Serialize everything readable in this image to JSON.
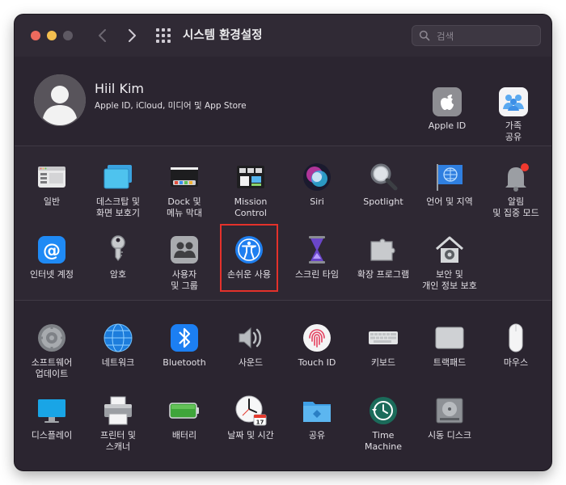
{
  "window": {
    "title": "시스템 환경설정"
  },
  "search": {
    "placeholder": "검색"
  },
  "account": {
    "name": "Hiil Kim",
    "subtitle": "Apple ID, iCloud, 미디어 및 App Store",
    "items": [
      {
        "label": "Apple ID",
        "icon": "apple-id-icon"
      },
      {
        "label": "가족\n공유",
        "icon": "family-sharing-icon"
      }
    ]
  },
  "section1": [
    {
      "label": "일반",
      "icon": "general-icon"
    },
    {
      "label": "데스크탑 및\n화면 보호기",
      "icon": "desktop-screensaver-icon"
    },
    {
      "label": "Dock 및\n메뉴 막대",
      "icon": "dock-menubar-icon"
    },
    {
      "label": "Mission\nControl",
      "icon": "mission-control-icon"
    },
    {
      "label": "Siri",
      "icon": "siri-icon"
    },
    {
      "label": "Spotlight",
      "icon": "spotlight-icon"
    },
    {
      "label": "언어 및 지역",
      "icon": "language-region-icon"
    },
    {
      "label": "알림\n및 집중 모드",
      "icon": "notifications-icon"
    },
    {
      "label": "인터넷 계정",
      "icon": "internet-accounts-icon"
    },
    {
      "label": "암호",
      "icon": "passwords-icon"
    },
    {
      "label": "사용자\n및 그룹",
      "icon": "users-groups-icon"
    },
    {
      "label": "손쉬운 사용",
      "icon": "accessibility-icon",
      "selected": true
    },
    {
      "label": "스크린 타임",
      "icon": "screen-time-icon"
    },
    {
      "label": "확장 프로그램",
      "icon": "extensions-icon"
    },
    {
      "label": "보안 및\n개인 정보 보호",
      "icon": "security-privacy-icon"
    }
  ],
  "section2": [
    {
      "label": "소프트웨어\n업데이트",
      "icon": "software-update-icon"
    },
    {
      "label": "네트워크",
      "icon": "network-icon"
    },
    {
      "label": "Bluetooth",
      "icon": "bluetooth-icon"
    },
    {
      "label": "사운드",
      "icon": "sound-icon"
    },
    {
      "label": "Touch ID",
      "icon": "touch-id-icon"
    },
    {
      "label": "키보드",
      "icon": "keyboard-icon"
    },
    {
      "label": "트랙패드",
      "icon": "trackpad-icon"
    },
    {
      "label": "마우스",
      "icon": "mouse-icon"
    },
    {
      "label": "디스플레이",
      "icon": "displays-icon"
    },
    {
      "label": "프린터 및\n스캐너",
      "icon": "printers-scanners-icon"
    },
    {
      "label": "배터리",
      "icon": "battery-icon"
    },
    {
      "label": "날짜 및 시간",
      "icon": "date-time-icon"
    },
    {
      "label": "공유",
      "icon": "sharing-icon"
    },
    {
      "label": "Time\nMachine",
      "icon": "time-machine-icon"
    },
    {
      "label": "시동 디스크",
      "icon": "startup-disk-icon"
    }
  ],
  "calendar_day": "17",
  "colors": {
    "accent": "#0a84ff",
    "selection": "#e4312b",
    "background": "#2b2530"
  }
}
